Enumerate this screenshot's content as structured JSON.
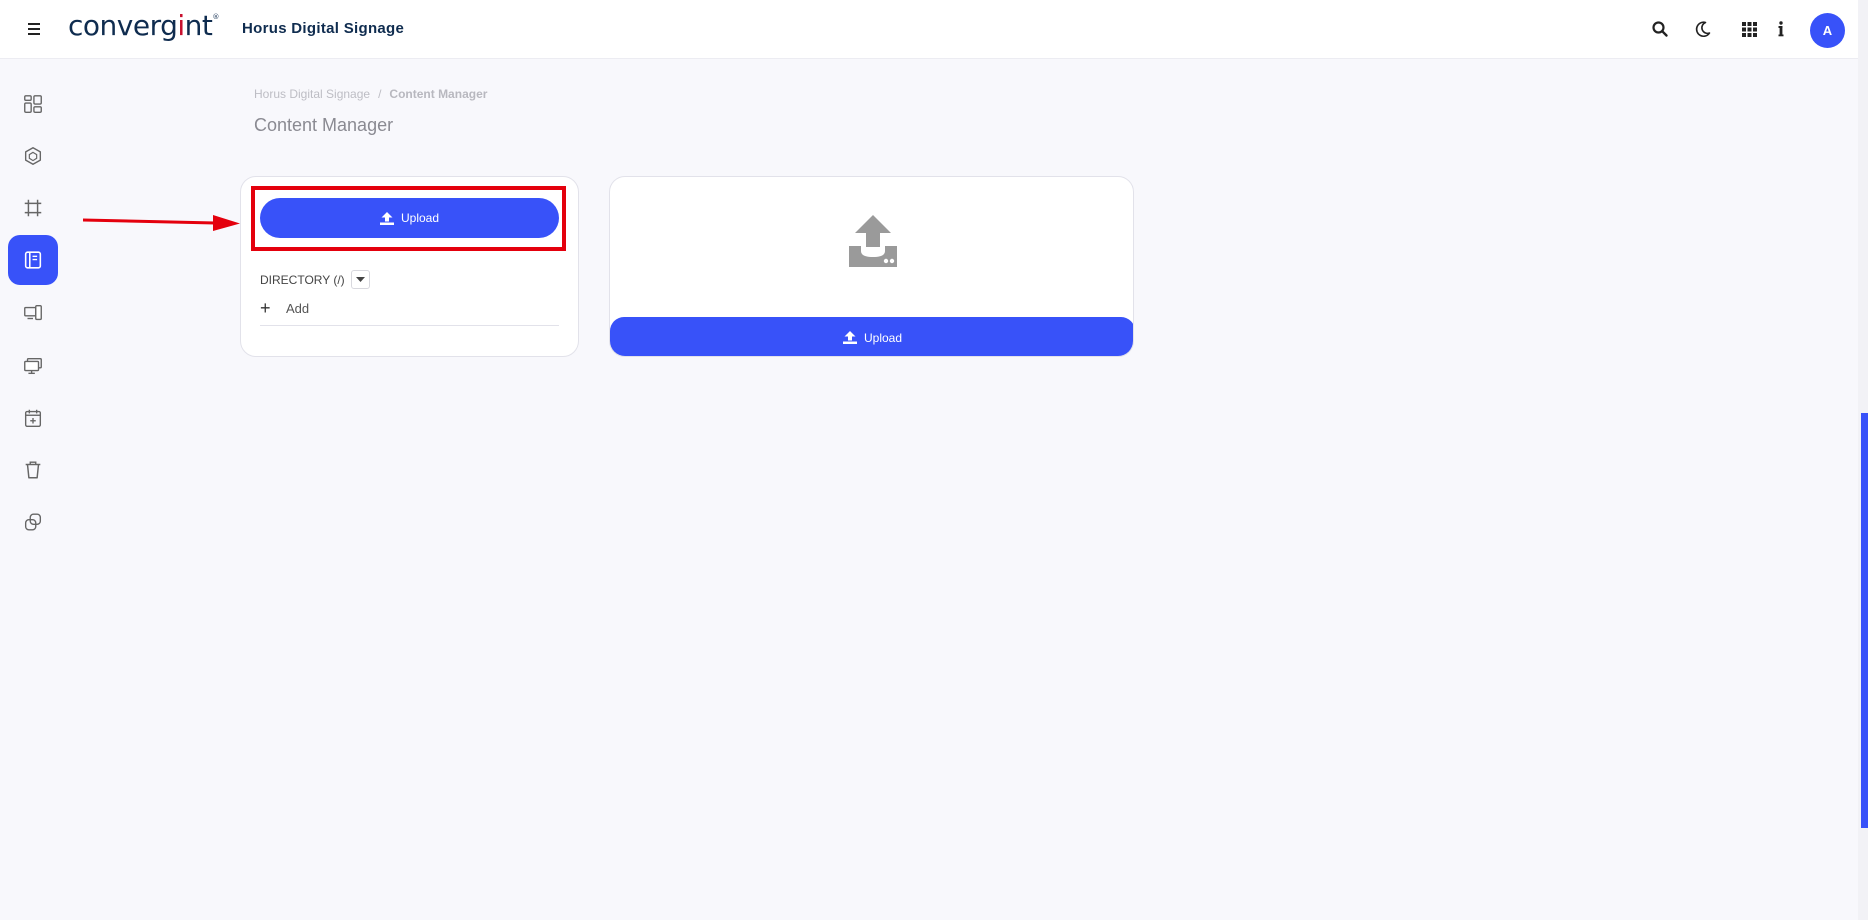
{
  "header": {
    "logo_text": "converg",
    "logo_accent": "i",
    "logo_end": "nt",
    "app_name": "Horus Digital Signage",
    "avatar_initial": "A"
  },
  "breadcrumb": {
    "root": "Horus Digital Signage",
    "separator": "/",
    "current": "Content Manager"
  },
  "page": {
    "title": "Content Manager"
  },
  "left_panel": {
    "upload_label": "Upload",
    "directory_label": "DIRECTORY (/)",
    "add_label": "Add"
  },
  "right_panel": {
    "upload_label": "Upload"
  },
  "sidebar": {
    "items": [
      "dashboard-icon",
      "cube-icon",
      "frame-icon",
      "content-icon",
      "devices-icon",
      "displays-icon",
      "calendar-add-icon",
      "trash-icon",
      "link-icon"
    ],
    "active": "content-icon"
  },
  "colors": {
    "accent": "#3852f9",
    "highlight": "#e4000d",
    "brand_navy": "#0f2c4f",
    "brand_red": "#c8102e"
  }
}
